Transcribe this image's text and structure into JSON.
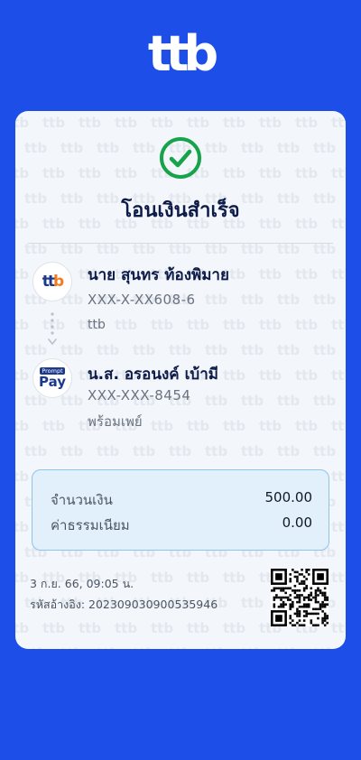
{
  "brand": {
    "logo_text": "ttb"
  },
  "receipt": {
    "title": "โอนเงินสำเร็จ",
    "status_icon": "check-circle-icon",
    "from": {
      "name": "นาย สุนทร ท้องพิมาย",
      "account": "XXX-X-XX608-6",
      "bank": "ttb",
      "logo_text": "ttb"
    },
    "to": {
      "name": "น.ส. อรอนงค์ เบ้ามี",
      "account": "XXX-XXX-8454",
      "bank": "พร้อมเพย์",
      "logo_top": "Prompt",
      "logo_bottom": "Pay"
    },
    "amount": {
      "label": "จำนวนเงิน",
      "value": "500.00"
    },
    "fee": {
      "label": "ค่าธรรมเนียม",
      "value": "0.00"
    },
    "datetime": "3 ก.ย. 66, 09:05 น.",
    "reference": "รหัสอ้างอิง: 2023090309005359 46"
  },
  "colors": {
    "background": "#1d4ee8",
    "card": "#f3f6fa",
    "success": "#16a34a",
    "amount_box": "#e2f0fb"
  }
}
